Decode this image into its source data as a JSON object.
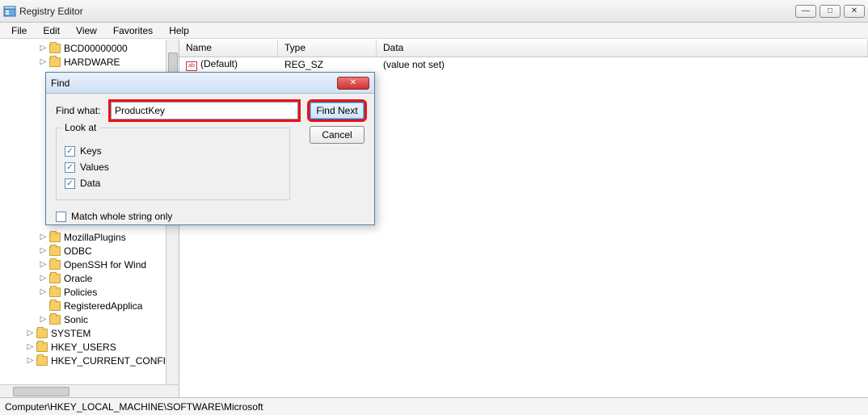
{
  "window": {
    "title": "Registry Editor"
  },
  "menu": {
    "file": "File",
    "edit": "Edit",
    "view": "View",
    "favorites": "Favorites",
    "help": "Help"
  },
  "tree": {
    "items": [
      {
        "label": "BCD00000000",
        "indent": 2
      },
      {
        "label": "HARDWARE",
        "indent": 2
      },
      {
        "label": "MozillaPlugins",
        "indent": 2
      },
      {
        "label": "ODBC",
        "indent": 2
      },
      {
        "label": "OpenSSH for Wind",
        "indent": 2
      },
      {
        "label": "Oracle",
        "indent": 2
      },
      {
        "label": "Policies",
        "indent": 2
      },
      {
        "label": "RegisteredApplica",
        "indent": 2
      },
      {
        "label": "Sonic",
        "indent": 2
      },
      {
        "label": "SYSTEM",
        "indent": 2
      },
      {
        "label": "HKEY_USERS",
        "indent": 1
      },
      {
        "label": "HKEY_CURRENT_CONFIG",
        "indent": 1
      }
    ]
  },
  "list": {
    "columns": {
      "name": "Name",
      "type": "Type",
      "data": "Data"
    },
    "rows": [
      {
        "name": "(Default)",
        "type": "REG_SZ",
        "data": "(value not set)"
      }
    ]
  },
  "status": {
    "path": "Computer\\HKEY_LOCAL_MACHINE\\SOFTWARE\\Microsoft"
  },
  "dialog": {
    "title": "Find",
    "find_what_label": "Find what:",
    "find_what_value": "ProductKey",
    "group_label": "Look at",
    "chk_keys": "Keys",
    "chk_values": "Values",
    "chk_data": "Data",
    "chk_whole": "Match whole string only",
    "btn_findnext": "Find Next",
    "btn_cancel": "Cancel",
    "checks": {
      "keys": true,
      "values": true,
      "data": true,
      "whole": false
    }
  }
}
